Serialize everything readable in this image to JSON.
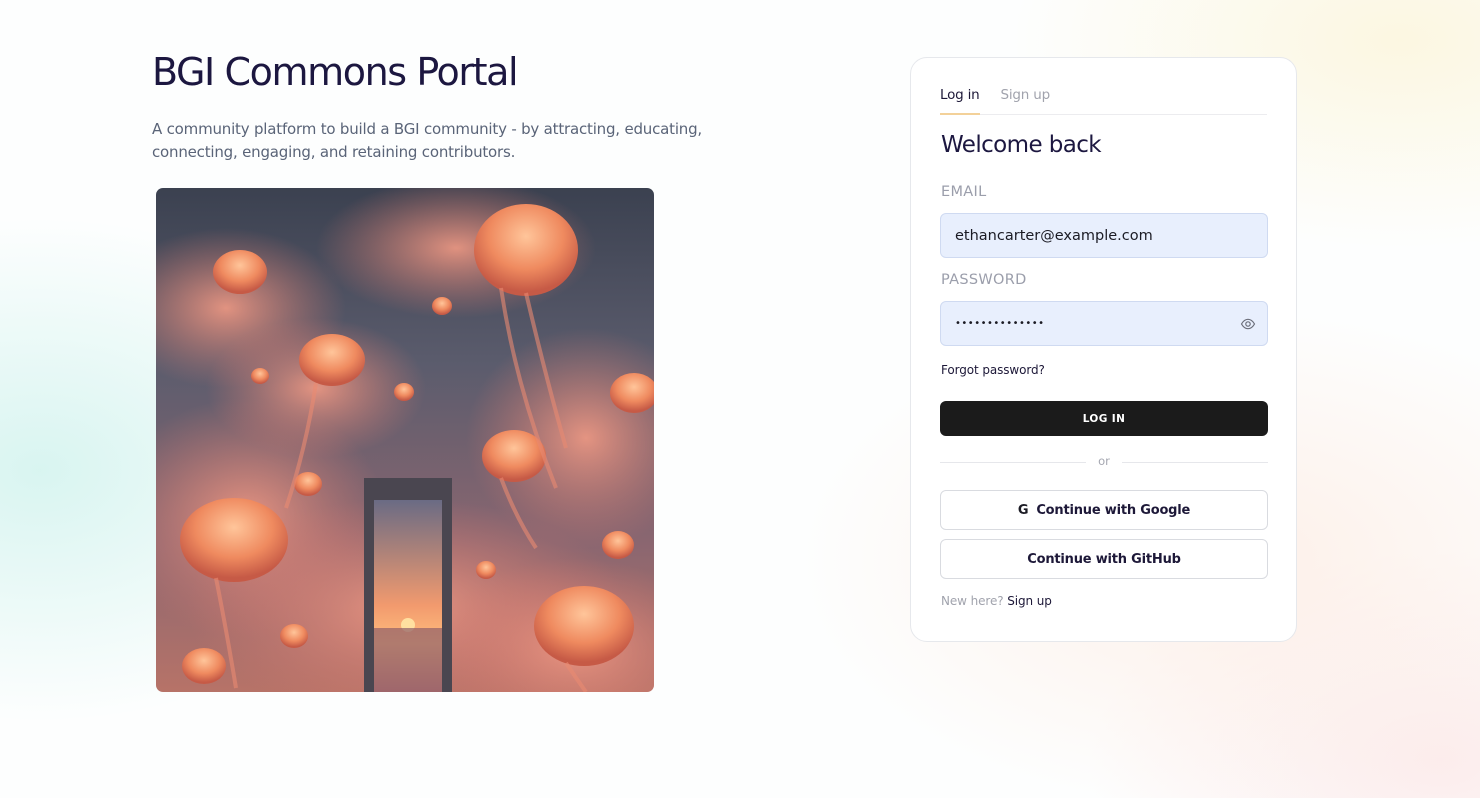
{
  "hero": {
    "title": "BGI Commons Portal",
    "description": "A community platform to build a BGI community - by attracting, educating, connecting, engaging, and retaining contributors."
  },
  "auth": {
    "tabs": [
      {
        "label": "Log in",
        "active": true
      },
      {
        "label": "Sign up",
        "active": false
      }
    ],
    "welcome": "Welcome back",
    "email": {
      "label": "EMAIL",
      "value": "ethancarter@example.com"
    },
    "password": {
      "label": "PASSWORD",
      "value": "••••••••••••••"
    },
    "forgot": "Forgot password?",
    "login_button": "LOG IN",
    "divider": "or",
    "google": {
      "icon_text": "G",
      "label": "Continue with Google"
    },
    "github": {
      "label": "Continue with GitHub"
    },
    "footer": {
      "prompt": "New here?",
      "link": "Sign up"
    }
  },
  "icons": {
    "eye": "eye-icon",
    "google": "google-icon"
  },
  "colors": {
    "accent_tab_underline": "#f3d199",
    "primary_button": "#1b1b1b",
    "input_bg": "#e8effd",
    "title": "#1c1740"
  }
}
